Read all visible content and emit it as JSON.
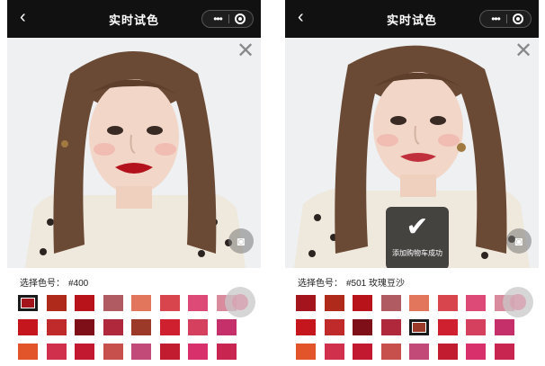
{
  "left_screen": {
    "nav": {
      "title": "实时试色",
      "back_icon": "chevron-left-icon",
      "more_icon": "more-dots-icon",
      "target_icon": "record-target-icon"
    },
    "shade_label": "选择色号：",
    "shade_code": "#400",
    "selected_index": 0,
    "toast": null
  },
  "right_screen": {
    "nav": {
      "title": "实时试色",
      "back_icon": "chevron-left-icon",
      "more_icon": "more-dots-icon",
      "target_icon": "record-target-icon"
    },
    "shade_label": "选择色号：",
    "shade_code": "#501 玫瑰豆沙",
    "selected_index": 12,
    "toast": "添加购物车成功"
  },
  "swatch_colors": [
    "#a3141c",
    "#b02a1c",
    "#b8121a",
    "#b05a62",
    "#e2765d",
    "#d9454c",
    "#de4a78",
    "#d98a9c",
    "#c5161e",
    "#c12a2a",
    "#7e0f18",
    "#b0283c",
    "#9c3a2a",
    "#cf2030",
    "#d5405e",
    "#c6306a",
    "#e2542a",
    "#d0304c",
    "#c21830",
    "#c8504c",
    "#c24a78",
    "#c21c30",
    "#d8306a",
    "#c82650"
  ]
}
